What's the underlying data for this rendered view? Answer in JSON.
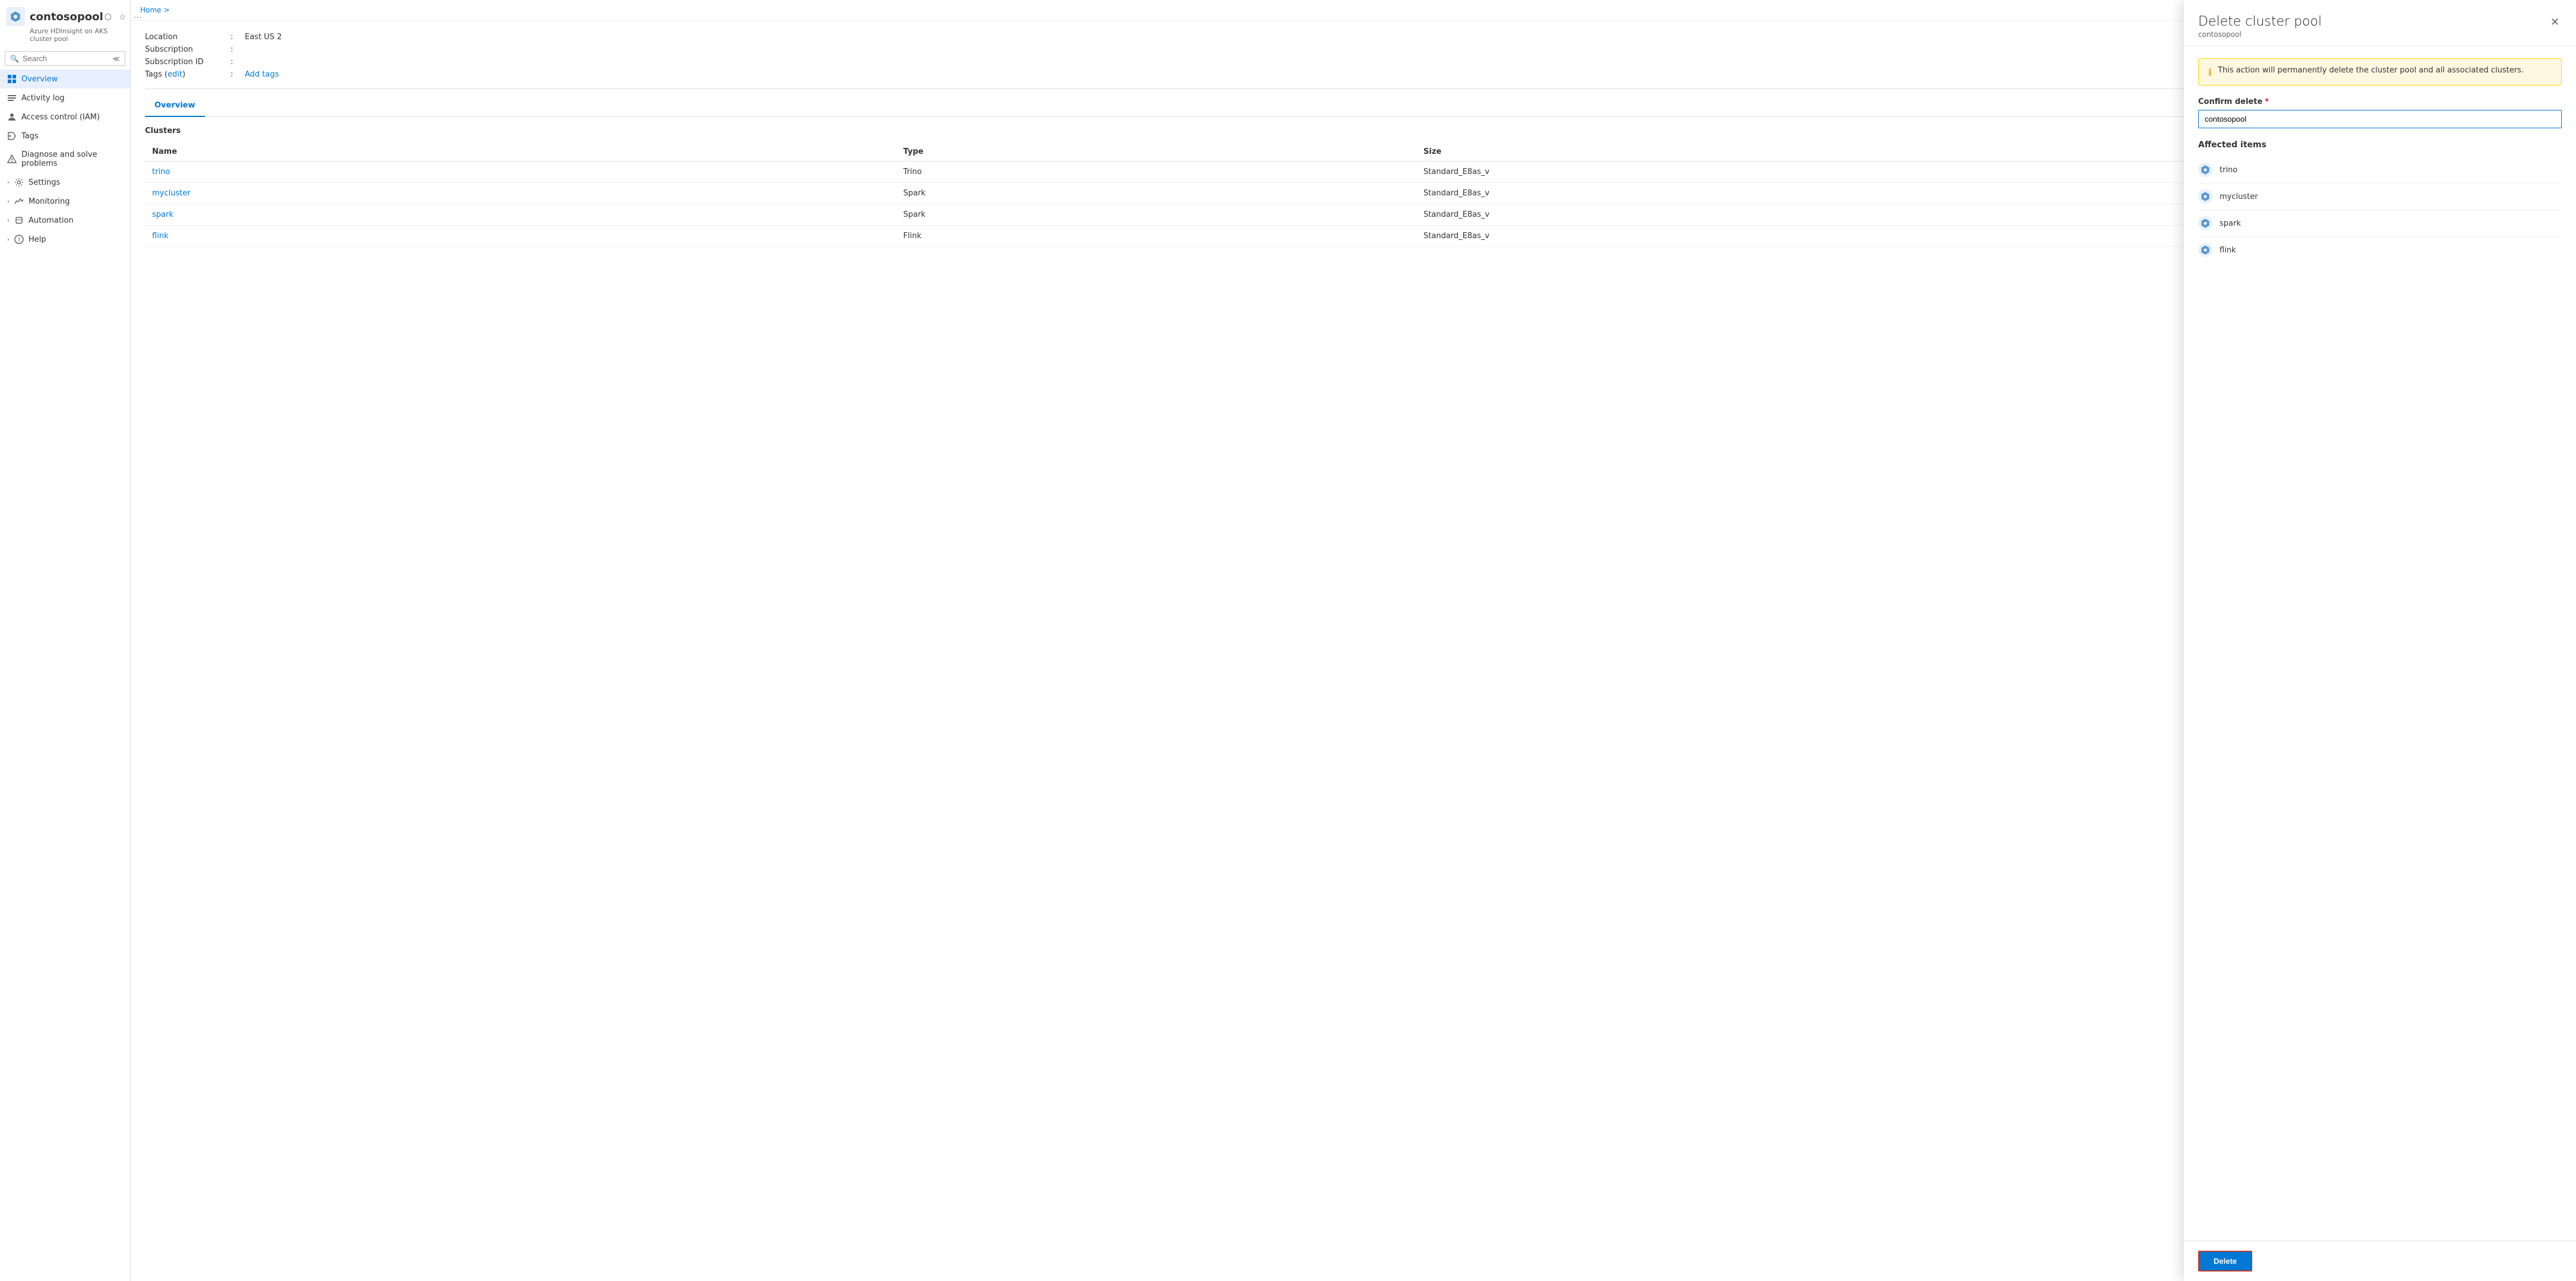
{
  "breadcrumb": {
    "home": "Home",
    "separator": ">"
  },
  "sidebar": {
    "resource_name": "contosopool",
    "resource_subtitle": "Azure HDInsight on AKS cluster pool",
    "search_placeholder": "Search",
    "collapse_tooltip": "Collapse",
    "nav_items": [
      {
        "id": "overview",
        "label": "Overview",
        "icon": "overview-icon",
        "active": true,
        "has_chevron": false
      },
      {
        "id": "activity-log",
        "label": "Activity log",
        "icon": "activity-icon",
        "active": false,
        "has_chevron": false
      },
      {
        "id": "access-control",
        "label": "Access control (IAM)",
        "icon": "iam-icon",
        "active": false,
        "has_chevron": false
      },
      {
        "id": "tags",
        "label": "Tags",
        "icon": "tags-icon",
        "active": false,
        "has_chevron": false
      },
      {
        "id": "diagnose",
        "label": "Diagnose and solve problems",
        "icon": "diagnose-icon",
        "active": false,
        "has_chevron": false
      },
      {
        "id": "settings",
        "label": "Settings",
        "icon": "settings-icon",
        "active": false,
        "has_chevron": true
      },
      {
        "id": "monitoring",
        "label": "Monitoring",
        "icon": "monitoring-icon",
        "active": false,
        "has_chevron": true
      },
      {
        "id": "automation",
        "label": "Automation",
        "icon": "automation-icon",
        "active": false,
        "has_chevron": true
      },
      {
        "id": "help",
        "label": "Help",
        "icon": "help-icon",
        "active": false,
        "has_chevron": true
      }
    ]
  },
  "main": {
    "info": {
      "location_label": "Location",
      "location_value": "East US 2",
      "subscription_label": "Subscription",
      "subscription_value": "",
      "subscription_id_label": "Subscription ID",
      "subscription_id_value": "",
      "tags_label": "Tags (edit)",
      "tags_edit_text": "edit",
      "tags_add_text": "Add tags"
    },
    "tab": "Overview",
    "clusters_section": "Clusters",
    "table": {
      "headers": [
        "Name",
        "Type",
        "Size"
      ],
      "rows": [
        {
          "name": "trino",
          "type": "Trino",
          "size": "Standard_E8as_v"
        },
        {
          "name": "mycluster",
          "type": "Spark",
          "size": "Standard_E8as_v"
        },
        {
          "name": "spark",
          "type": "Spark",
          "size": "Standard_E8as_v"
        },
        {
          "name": "flink",
          "type": "Flink",
          "size": "Standard_E8as_v"
        }
      ]
    }
  },
  "delete_panel": {
    "title": "Delete cluster pool",
    "subtitle": "contosopool",
    "warning_text": "This action will permanently delete the cluster pool and all associated clusters.",
    "confirm_label": "Confirm delete",
    "confirm_value": "contosopool",
    "confirm_placeholder": "contosopool",
    "affected_title": "Affected items",
    "affected_items": [
      {
        "name": "trino"
      },
      {
        "name": "mycluster"
      },
      {
        "name": "spark"
      },
      {
        "name": "flink"
      }
    ],
    "delete_button_label": "Delete"
  }
}
